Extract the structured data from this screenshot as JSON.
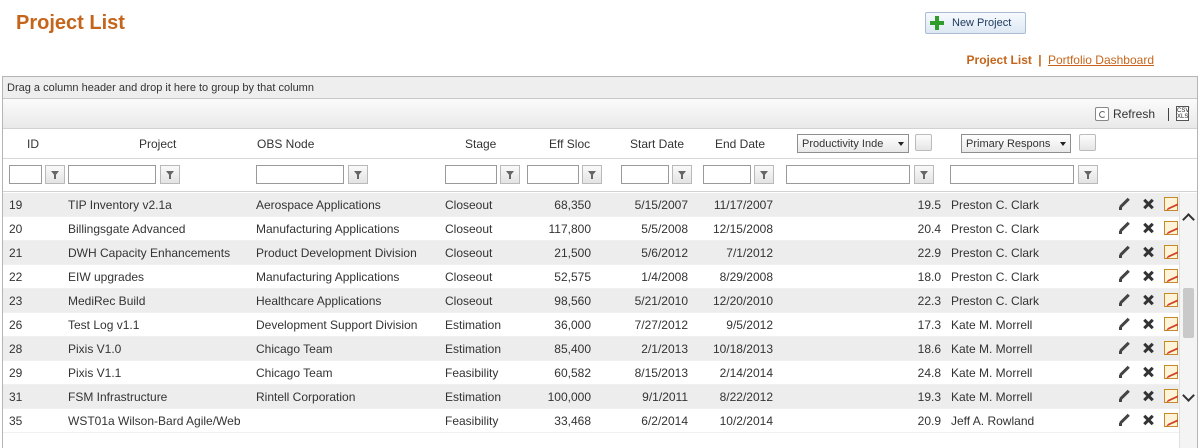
{
  "page": {
    "title": "Project List",
    "new_button": "New Project"
  },
  "nav": {
    "active": "Project List",
    "separator": "|",
    "link": "Portfolio Dashboard"
  },
  "grid": {
    "group_panel": "Drag a column header and drop it here to group by that column",
    "toolbar": {
      "refresh": "Refresh",
      "separator": "|",
      "export_lines": [
        "CSV",
        "XLS"
      ]
    },
    "columns": {
      "id": "ID",
      "project": "Project",
      "obs": "OBS Node",
      "stage": "Stage",
      "effsloc": "Eff Sloc",
      "start": "Start Date",
      "end": "End Date",
      "productivity": "Productivity Inde",
      "primary": "Primary Respons"
    },
    "rows": [
      {
        "id": "19",
        "project": "TIP Inventory v2.1a",
        "obs": "Aerospace Applications",
        "stage": "Closeout",
        "effsloc": "68,350",
        "start": "5/15/2007",
        "end": "11/17/2007",
        "productivity": "19.5",
        "primary": "Preston C. Clark"
      },
      {
        "id": "20",
        "project": "Billingsgate Advanced",
        "obs": "Manufacturing Applications",
        "stage": "Closeout",
        "effsloc": "117,800",
        "start": "5/5/2008",
        "end": "12/15/2008",
        "productivity": "20.4",
        "primary": "Preston C. Clark"
      },
      {
        "id": "21",
        "project": "DWH Capacity Enhancements",
        "obs": "Product Development Division",
        "stage": "Closeout",
        "effsloc": "21,500",
        "start": "5/6/2012",
        "end": "7/1/2012",
        "productivity": "22.9",
        "primary": "Preston C. Clark"
      },
      {
        "id": "22",
        "project": "EIW upgrades",
        "obs": "Manufacturing Applications",
        "stage": "Closeout",
        "effsloc": "52,575",
        "start": "1/4/2008",
        "end": "8/29/2008",
        "productivity": "18.0",
        "primary": "Preston C. Clark"
      },
      {
        "id": "23",
        "project": "MediRec Build",
        "obs": "Healthcare Applications",
        "stage": "Closeout",
        "effsloc": "98,560",
        "start": "5/21/2010",
        "end": "12/20/2010",
        "productivity": "22.3",
        "primary": "Preston C. Clark"
      },
      {
        "id": "26",
        "project": "Test Log v1.1",
        "obs": "Development Support Division",
        "stage": "Estimation",
        "effsloc": "36,000",
        "start": "7/27/2012",
        "end": "9/5/2012",
        "productivity": "17.3",
        "primary": "Kate M. Morrell"
      },
      {
        "id": "28",
        "project": "Pixis V1.0",
        "obs": "Chicago Team",
        "stage": "Estimation",
        "effsloc": "85,400",
        "start": "2/1/2013",
        "end": "10/18/2013",
        "productivity": "18.6",
        "primary": "Kate M. Morrell"
      },
      {
        "id": "29",
        "project": "Pixis V1.1",
        "obs": "Chicago Team",
        "stage": "Feasibility",
        "effsloc": "60,582",
        "start": "8/15/2013",
        "end": "2/14/2014",
        "productivity": "24.8",
        "primary": "Kate M. Morrell"
      },
      {
        "id": "31",
        "project": "FSM Infrastructure",
        "obs": "Rintell Corporation",
        "stage": "Estimation",
        "effsloc": "100,000",
        "start": "9/1/2011",
        "end": "8/22/2012",
        "productivity": "19.3",
        "primary": "Kate M. Morrell"
      },
      {
        "id": "35",
        "project": "WST01a Wilson-Bard Agile/Web",
        "obs": "",
        "stage": "Feasibility",
        "effsloc": "33,468",
        "start": "6/2/2014",
        "end": "10/2/2014",
        "productivity": "20.9",
        "primary": "Jeff A. Rowland"
      }
    ]
  }
}
